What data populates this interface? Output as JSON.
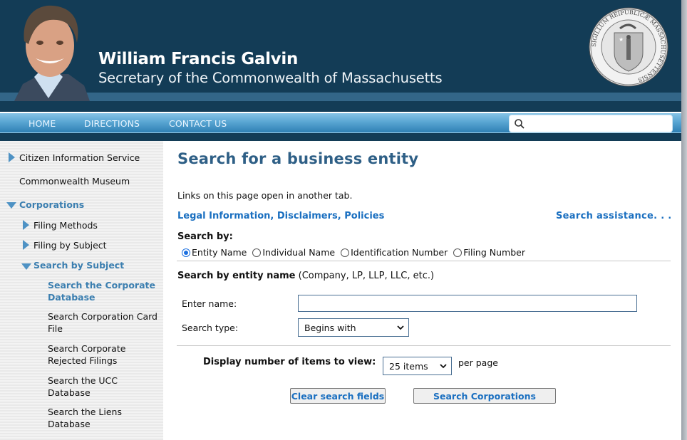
{
  "header": {
    "name": "William Francis Galvin",
    "subtitle": "Secretary of the Commonwealth of Massachusetts",
    "portrait": "portrait-photo",
    "seal": "massachusetts-seal",
    "seal_text": "SIGILLUM REIPUBLICÆ MASSACHUSETTENSIS"
  },
  "nav": {
    "items": [
      {
        "label": "HOME"
      },
      {
        "label": "DIRECTIONS"
      },
      {
        "label": "CONTACT US"
      }
    ],
    "search": {
      "placeholder": "",
      "value": "",
      "icon": "search-icon"
    }
  },
  "sidebar": {
    "items": [
      {
        "label": "Citizen Information Service",
        "icon": "triangle-right-icon",
        "level": 0
      },
      {
        "label": "Commonwealth Museum",
        "level": 0
      },
      {
        "label": "Corporations",
        "icon": "triangle-down-icon",
        "level": 0,
        "active": true
      },
      {
        "label": "Filing Methods",
        "icon": "triangle-right-icon",
        "level": 1
      },
      {
        "label": "Filing by Subject",
        "icon": "triangle-right-icon",
        "level": 1
      },
      {
        "label": "Search by Subject",
        "icon": "triangle-down-icon",
        "level": 1,
        "active": true
      },
      {
        "label_lines": [
          "Search the Corporate",
          "Database"
        ],
        "level": 2,
        "active": true
      },
      {
        "label_lines": [
          "Search Corporation Card",
          "File"
        ],
        "level": 2
      },
      {
        "label_lines": [
          "Search Corporate",
          "Rejected Filings"
        ],
        "level": 2
      },
      {
        "label_lines": [
          "Search the UCC",
          "Database"
        ],
        "level": 2
      },
      {
        "label_lines": [
          "Search the Liens",
          "Database"
        ],
        "level": 2
      }
    ]
  },
  "main": {
    "title": "Search for a business entity",
    "info": "Links on this page open in another tab.",
    "legal_link": "Legal Information, Disclaimers, Policies",
    "assist_link": "Search assistance. . .",
    "search_by_label": "Search by:",
    "search_by_options": [
      {
        "label": "Entity Name",
        "checked": true
      },
      {
        "label": "Individual Name",
        "checked": false
      },
      {
        "label": "Identification Number",
        "checked": false
      },
      {
        "label": "Filing Number",
        "checked": false
      }
    ],
    "section_title": "Search by entity name",
    "section_hint": "(Company, LP, LLP, LLC, etc.)",
    "enter_name_label": "Enter name:",
    "enter_name_value": "",
    "search_type_label": "Search type:",
    "search_type_value": "Begins with",
    "display_label": "Display number of items to view:",
    "display_value": "25 items",
    "per_page": "per page",
    "clear_button": "Clear search fields",
    "search_button": "Search Corporations"
  },
  "colors": {
    "header_bg": "#133c56",
    "nav_accent": "#5aa6d3",
    "title": "#2e5f86",
    "link": "#1a6fc0",
    "sidebar_active": "#3c7fb0"
  }
}
